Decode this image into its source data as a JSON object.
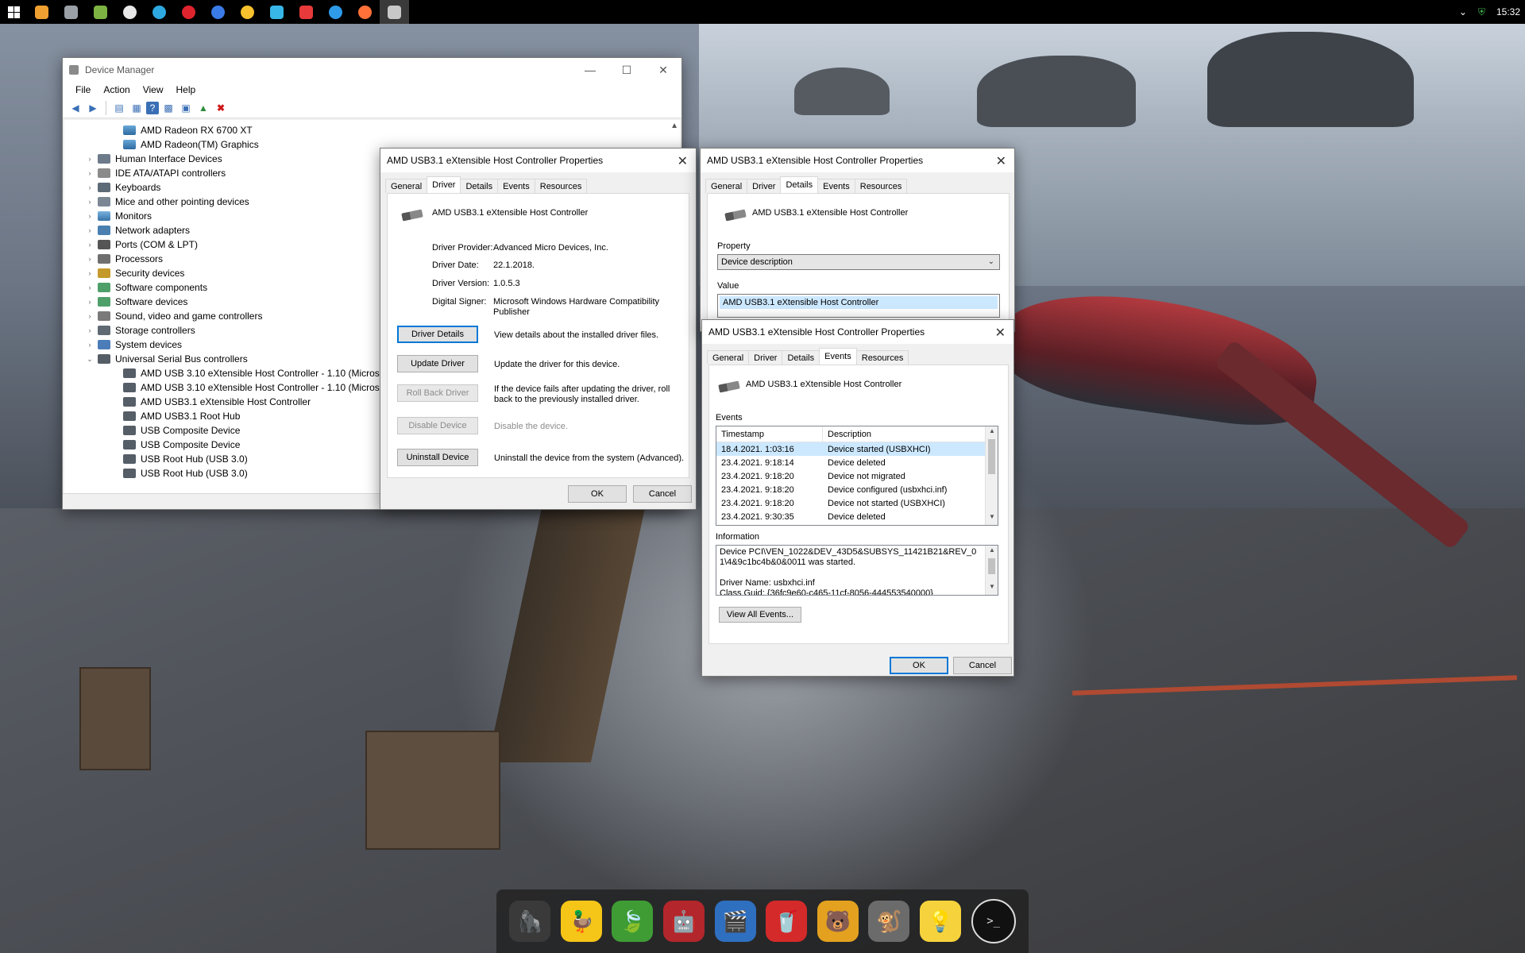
{
  "taskbar": {
    "icons": [
      {
        "name": "search-icon",
        "color": "#f0a030"
      },
      {
        "name": "terminal-icon",
        "color": "#9aa0a6"
      },
      {
        "name": "app-icon",
        "color": "#7cb342"
      },
      {
        "name": "globe-icon",
        "color": "#e8e8e8"
      },
      {
        "name": "edge-icon",
        "color": "#2ea8e0"
      },
      {
        "name": "opera-icon",
        "color": "#e0242e"
      },
      {
        "name": "firefox-dev-icon",
        "color": "#3a7be8"
      },
      {
        "name": "chrome-canary-icon",
        "color": "#f7c22e"
      },
      {
        "name": "app-bird-icon",
        "color": "#38b6e8"
      },
      {
        "name": "vivaldi-icon",
        "color": "#e83a3a"
      },
      {
        "name": "safari-icon",
        "color": "#2e9ae8"
      },
      {
        "name": "firefox-icon",
        "color": "#ff7139"
      },
      {
        "name": "device-manager-icon",
        "color": "#c8c8c8"
      }
    ],
    "clock": "15:32"
  },
  "device_manager": {
    "title": "Device Manager",
    "menu": [
      "File",
      "Action",
      "View",
      "Help"
    ],
    "tree": [
      {
        "label": "AMD Radeon RX 6700 XT",
        "level": 1,
        "icon": "ic-gpu",
        "exp": ""
      },
      {
        "label": "AMD Radeon(TM) Graphics",
        "level": 1,
        "icon": "ic-gpu",
        "exp": ""
      },
      {
        "label": "Human Interface Devices",
        "level": 0,
        "icon": "ic-hid",
        "exp": "›"
      },
      {
        "label": "IDE ATA/ATAPI controllers",
        "level": 0,
        "icon": "ic-ide",
        "exp": "›"
      },
      {
        "label": "Keyboards",
        "level": 0,
        "icon": "ic-kb",
        "exp": "›"
      },
      {
        "label": "Mice and other pointing devices",
        "level": 0,
        "icon": "ic-mouse",
        "exp": "›"
      },
      {
        "label": "Monitors",
        "level": 0,
        "icon": "ic-mon",
        "exp": "›"
      },
      {
        "label": "Network adapters",
        "level": 0,
        "icon": "ic-net",
        "exp": "›"
      },
      {
        "label": "Ports (COM & LPT)",
        "level": 0,
        "icon": "ic-port",
        "exp": "›"
      },
      {
        "label": "Processors",
        "level": 0,
        "icon": "ic-cpu",
        "exp": "›"
      },
      {
        "label": "Security devices",
        "level": 0,
        "icon": "ic-sec",
        "exp": "›"
      },
      {
        "label": "Software components",
        "level": 0,
        "icon": "ic-sw",
        "exp": "›"
      },
      {
        "label": "Software devices",
        "level": 0,
        "icon": "ic-sw",
        "exp": "›"
      },
      {
        "label": "Sound, video and game controllers",
        "level": 0,
        "icon": "ic-snd",
        "exp": "›"
      },
      {
        "label": "Storage controllers",
        "level": 0,
        "icon": "ic-stor",
        "exp": "›"
      },
      {
        "label": "System devices",
        "level": 0,
        "icon": "ic-sys",
        "exp": "›"
      },
      {
        "label": "Universal Serial Bus controllers",
        "level": 0,
        "icon": "ic-usb",
        "exp": "⌄"
      },
      {
        "label": "AMD USB 3.10 eXtensible Host Controller - 1.10 (Microsoft)",
        "level": 1,
        "icon": "ic-usb",
        "exp": ""
      },
      {
        "label": "AMD USB 3.10 eXtensible Host Controller - 1.10 (Microsoft)",
        "level": 1,
        "icon": "ic-usb",
        "exp": ""
      },
      {
        "label": "AMD USB3.1 eXtensible Host Controller",
        "level": 1,
        "icon": "ic-usb",
        "exp": ""
      },
      {
        "label": "AMD USB3.1 Root Hub",
        "level": 1,
        "icon": "ic-usb",
        "exp": ""
      },
      {
        "label": "USB Composite Device",
        "level": 1,
        "icon": "ic-usb",
        "exp": ""
      },
      {
        "label": "USB Composite Device",
        "level": 1,
        "icon": "ic-usb",
        "exp": ""
      },
      {
        "label": "USB Root Hub (USB 3.0)",
        "level": 1,
        "icon": "ic-usb",
        "exp": ""
      },
      {
        "label": "USB Root Hub (USB 3.0)",
        "level": 1,
        "icon": "ic-usb",
        "exp": ""
      }
    ]
  },
  "driver_dialog": {
    "title": "AMD USB3.1 eXtensible Host Controller Properties",
    "tabs": [
      "General",
      "Driver",
      "Details",
      "Events",
      "Resources"
    ],
    "device_name": "AMD USB3.1 eXtensible Host Controller",
    "provider_label": "Driver Provider:",
    "provider": "Advanced Micro Devices, Inc.",
    "date_label": "Driver Date:",
    "date": "22.1.2018.",
    "version_label": "Driver Version:",
    "version": "1.0.5.3",
    "signer_label": "Digital Signer:",
    "signer": "Microsoft Windows Hardware Compatibility Publisher",
    "btn_details": "Driver Details",
    "desc_details": "View details about the installed driver files.",
    "btn_update": "Update Driver",
    "desc_update": "Update the driver for this device.",
    "btn_rollback": "Roll Back Driver",
    "desc_rollback": "If the device fails after updating the driver, roll back to the previously installed driver.",
    "btn_disable": "Disable Device",
    "desc_disable": "Disable the device.",
    "btn_uninstall": "Uninstall Device",
    "desc_uninstall": "Uninstall the device from the system (Advanced).",
    "ok": "OK",
    "cancel": "Cancel"
  },
  "details_dialog": {
    "title": "AMD USB3.1 eXtensible Host Controller Properties",
    "tabs": [
      "General",
      "Driver",
      "Details",
      "Events",
      "Resources"
    ],
    "device_name": "AMD USB3.1 eXtensible Host Controller",
    "property_label": "Property",
    "property_value": "Device description",
    "value_label": "Value",
    "value": "AMD USB3.1 eXtensible Host Controller"
  },
  "events_dialog": {
    "title": "AMD USB3.1 eXtensible Host Controller Properties",
    "tabs": [
      "General",
      "Driver",
      "Details",
      "Events",
      "Resources"
    ],
    "device_name": "AMD USB3.1 eXtensible Host Controller",
    "events_label": "Events",
    "col_timestamp": "Timestamp",
    "col_description": "Description",
    "events": [
      {
        "ts": "18.4.2021. 1:03:16",
        "desc": "Device started (USBXHCI)"
      },
      {
        "ts": "23.4.2021. 9:18:14",
        "desc": "Device deleted"
      },
      {
        "ts": "23.4.2021. 9:18:20",
        "desc": "Device not migrated"
      },
      {
        "ts": "23.4.2021. 9:18:20",
        "desc": "Device configured (usbxhci.inf)"
      },
      {
        "ts": "23.4.2021. 9:18:20",
        "desc": "Device not started (USBXHCI)"
      },
      {
        "ts": "23.4.2021. 9:30:35",
        "desc": "Device deleted"
      }
    ],
    "information_label": "Information",
    "information": "Device PCI\\VEN_1022&DEV_43D5&SUBSYS_11421B21&REV_01\\4&9c1bc4b&0&0011 was started.\n\nDriver Name: usbxhci.inf\nClass Guid: {36fc9e60-c465-11cf-8056-444553540000}",
    "view_all": "View All Events...",
    "ok": "OK",
    "cancel": "Cancel"
  },
  "dock": {
    "items": [
      {
        "name": "gorilla-app-icon",
        "glyph": "🦍",
        "color": "#3a3a3a"
      },
      {
        "name": "duck-app-icon",
        "glyph": "🦆",
        "color": "#f5c518"
      },
      {
        "name": "leaf-app-icon",
        "glyph": "🍃",
        "color": "#3f9c35"
      },
      {
        "name": "ironman-app-icon",
        "glyph": "🤖",
        "color": "#b3262b"
      },
      {
        "name": "clapperboard-app-icon",
        "glyph": "🎬",
        "color": "#2f6fc0"
      },
      {
        "name": "soda-app-icon",
        "glyph": "🥤",
        "color": "#d42a2a"
      },
      {
        "name": "bear-app-icon",
        "glyph": "🐻",
        "color": "#e3a11f"
      },
      {
        "name": "monkey-app-icon",
        "glyph": "🐒",
        "color": "#6b6b6b"
      },
      {
        "name": "lightbulb-app-icon",
        "glyph": "💡",
        "color": "#f6d33c"
      }
    ],
    "terminal_glyph": ">_"
  }
}
